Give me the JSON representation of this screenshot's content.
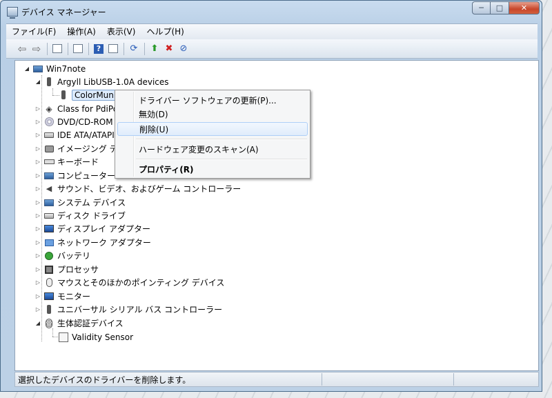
{
  "window": {
    "title": "デバイス マネージャー",
    "controls": {
      "minimize": "─",
      "maximize": "□",
      "close": "✕"
    }
  },
  "menubar": {
    "items": [
      {
        "label": "ファイル(F)"
      },
      {
        "label": "操作(A)"
      },
      {
        "label": "表示(V)"
      },
      {
        "label": "ヘルプ(H)"
      }
    ]
  },
  "toolbar": {
    "back_icon": "⇦",
    "forward_icon": "⇨",
    "help_icon": "?"
  },
  "tree": {
    "root": "Win7note",
    "nodes": [
      {
        "label": "Argyll LibUSB-1.0A devices",
        "expanded": true,
        "icon": "usb-icon"
      },
      {
        "label": "ColorMunki",
        "child": true,
        "selected": true,
        "icon": "usb-icon"
      },
      {
        "label": "Class for PdiPo",
        "icon": "diamond-icon"
      },
      {
        "label": "DVD/CD-ROM",
        "icon": "disc-icon"
      },
      {
        "label": "IDE ATA/ATAPI",
        "icon": "drive-icon"
      },
      {
        "label": "イメージング デ",
        "icon": "camera-icon"
      },
      {
        "label": "キーボード",
        "icon": "keyboard-icon"
      },
      {
        "label": "コンピューター",
        "icon": "computer-icon"
      },
      {
        "label": "サウンド、ビデオ、およびゲーム コントローラー",
        "icon": "speaker-icon"
      },
      {
        "label": "システム デバイス",
        "icon": "computer-icon"
      },
      {
        "label": "ディスク ドライブ",
        "icon": "drive-icon"
      },
      {
        "label": "ディスプレイ アダプター",
        "icon": "monitor-icon"
      },
      {
        "label": "ネットワーク アダプター",
        "icon": "network-icon"
      },
      {
        "label": "バッテリ",
        "icon": "battery-icon"
      },
      {
        "label": "プロセッサ",
        "icon": "chip-icon"
      },
      {
        "label": "マウスとそのほかのポインティング デバイス",
        "icon": "mouse-icon"
      },
      {
        "label": "モニター",
        "icon": "monitor-icon"
      },
      {
        "label": "ユニバーサル シリアル バス コントローラー",
        "icon": "usb-icon"
      },
      {
        "label": "生体認証デバイス",
        "expanded": true,
        "icon": "fingerprint-icon"
      },
      {
        "label": "Validity Sensor",
        "child": true,
        "icon": "card-icon"
      }
    ]
  },
  "context_menu": {
    "items": [
      {
        "label": "ドライバー ソフトウェアの更新(P)..."
      },
      {
        "label": "無効(D)"
      },
      {
        "label": "削除(U)"
      },
      {
        "label": "ハードウェア変更のスキャン(A)"
      },
      {
        "label": "プロパティ(R)"
      }
    ]
  },
  "statusbar": {
    "text": "選択したデバイスのドライバーを削除します。"
  }
}
